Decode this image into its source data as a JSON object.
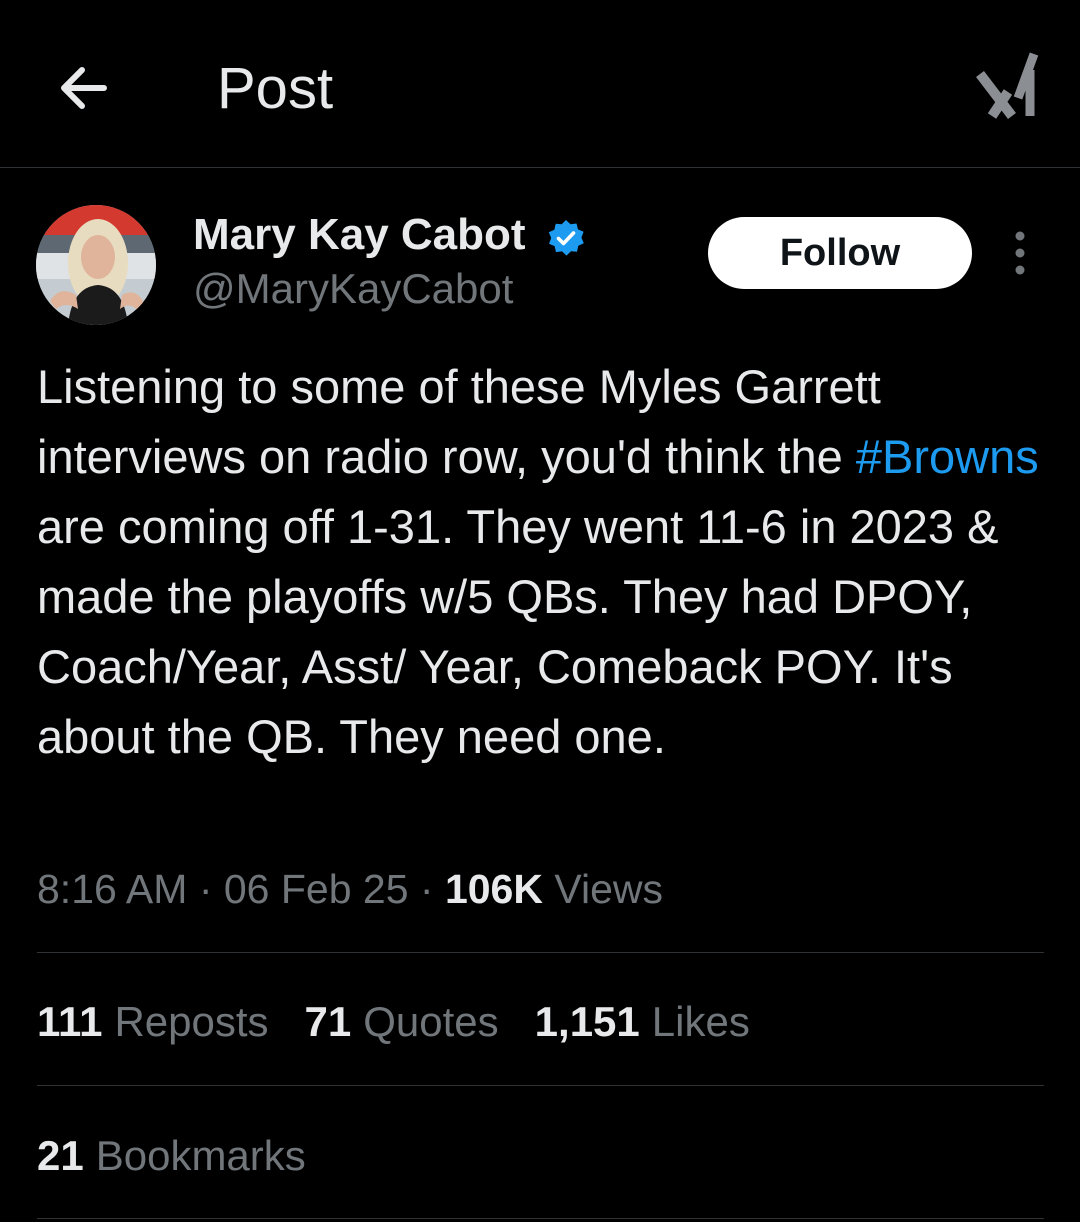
{
  "header": {
    "title": "Post",
    "back_icon": "arrow-left-icon",
    "grok_icon": "grok-icon"
  },
  "author": {
    "display_name": "Mary Kay Cabot",
    "handle": "@MaryKayCabot",
    "verified": true,
    "verified_color": "#1d9bf0"
  },
  "follow": {
    "label": "Follow"
  },
  "post": {
    "text_line1": "Listening to some of these Myles Garrett interviews on radio row, you'd think the ",
    "hashtag": "#Browns",
    "text_line2": " are coming off 1-31. They went 11-6 in 2023 & made the playoffs w/5 QBs. They had DPOY, Coach/Year, Asst/ Year, Comeback POY. It's about the QB. They need one."
  },
  "meta": {
    "time": "8:16 AM",
    "sep1": " · ",
    "date": "06 Feb 25",
    "sep2": " · ",
    "views_count": "106K",
    "views_label": " Views"
  },
  "stats": {
    "reposts": {
      "count": "111",
      "label": "Reposts"
    },
    "quotes": {
      "count": "71",
      "label": "Quotes"
    },
    "likes": {
      "count": "1,151",
      "label": "Likes"
    },
    "bookmarks": {
      "count": "21",
      "label": "Bookmarks"
    }
  },
  "colors": {
    "background": "#000000",
    "text": "#e7e9ea",
    "secondary": "#71767b",
    "accent": "#1d9bf0",
    "divider": "#2f3336"
  }
}
